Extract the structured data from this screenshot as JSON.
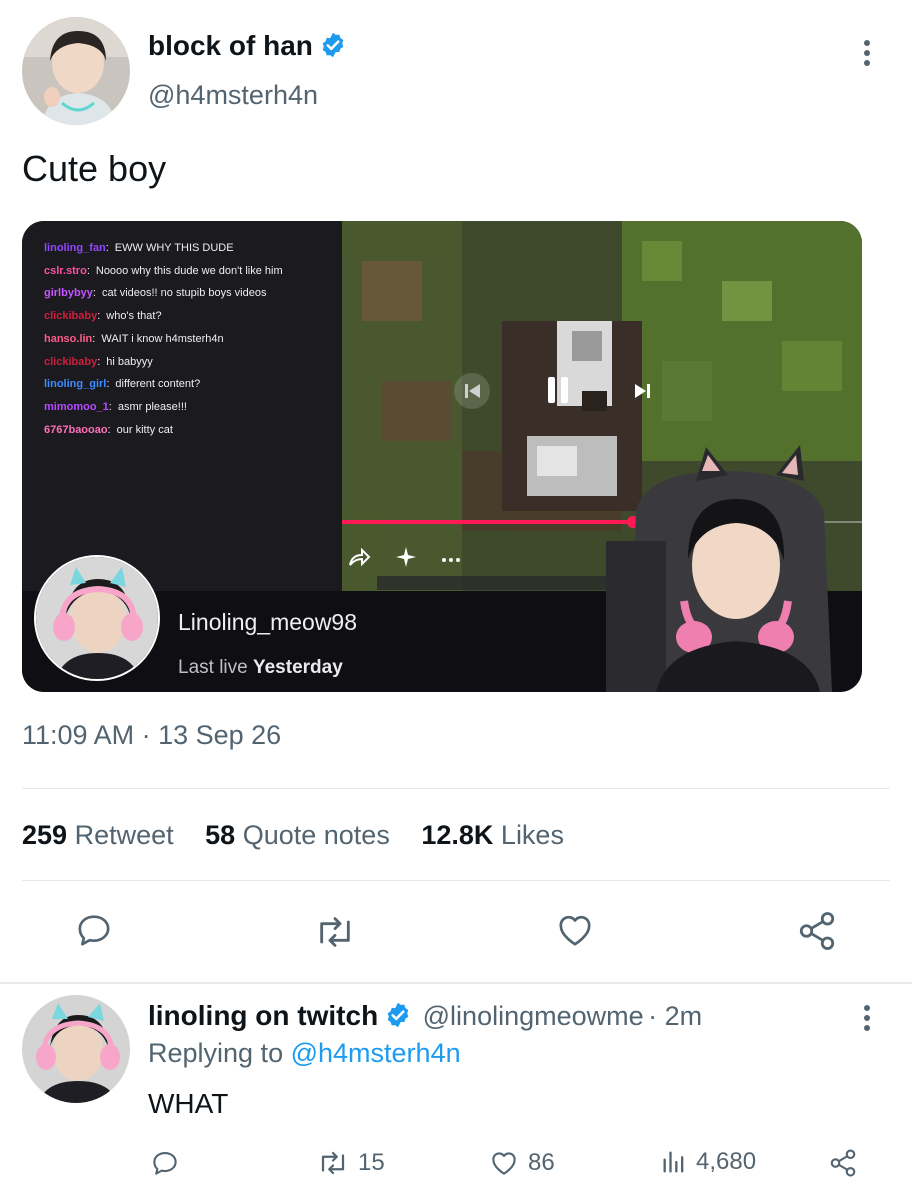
{
  "tweet": {
    "author": {
      "display_name": "block of han",
      "handle": "@h4msterh4n",
      "verified": true
    },
    "text": "Cute boy",
    "media": {
      "chat": [
        {
          "user": "linoling_fan",
          "sep": ":",
          "msg": "EWW WHY THIS DUDE",
          "color": "#9147ff"
        },
        {
          "user": "cslr.stro",
          "sep": ":",
          "msg": "Noooo why this dude we don't like him",
          "color": "#ff4fa3"
        },
        {
          "user": "girlbybyy",
          "sep": ":",
          "msg": "cat videos!! no stupib boys videos",
          "color": "#c653ff"
        },
        {
          "user": "clickibaby",
          "sep": ":",
          "msg": "who's that?",
          "color": "#d01f3c"
        },
        {
          "user": "hanso.lin",
          "sep": ":",
          "msg": "WAIT i know h4msterh4n",
          "color": "#ff5a8a"
        },
        {
          "user": "clickibaby",
          "sep": ":",
          "msg": "hi babyyy",
          "color": "#d01f3c"
        },
        {
          "user": "linoling_girl",
          "sep": ":",
          "msg": "different content?",
          "color": "#3d8bff"
        },
        {
          "user": "mimomoo_1",
          "sep": ":",
          "msg": "asmr please!!!",
          "color": "#b54bff"
        },
        {
          "user": "6767baooao",
          "sep": ":",
          "msg": "our kitty cat",
          "color": "#ff6fb8"
        }
      ],
      "progress_fraction": 0.56,
      "stream_name": "Linoling_meow98",
      "last_live_prefix": "Last live",
      "last_live_value": "Yesterday",
      "controls": {
        "prev_icon": "skip-previous-icon",
        "pause_icon": "pause-icon",
        "next_icon": "skip-next-icon",
        "share_icon": "share-arrow-icon",
        "sparkle_icon": "sparkle-icon",
        "more_icon": "more-dots-icon"
      }
    },
    "timestamp": "11:09 AM · 13 Sep 26",
    "stats": {
      "retweets": "259",
      "retweets_label": "Retweet",
      "quotes": "58",
      "quotes_label": "Quote notes",
      "likes": "12.8K",
      "likes_label": "Likes"
    },
    "actions": [
      "reply-icon",
      "retweet-icon",
      "like-icon",
      "share-icon"
    ]
  },
  "reply": {
    "display_name": "linoling on twitch",
    "handle": "@linolingmeowme",
    "time": "· 2m",
    "replying_prefix": "Replying to",
    "replying_to": "@h4msterh4n",
    "text": "WHAT",
    "retweets": "15",
    "likes": "86",
    "views": "4,680"
  },
  "colors": {
    "accent": "#1d9bf0",
    "stream_red": "#ff1a55",
    "muted": "#536471"
  }
}
